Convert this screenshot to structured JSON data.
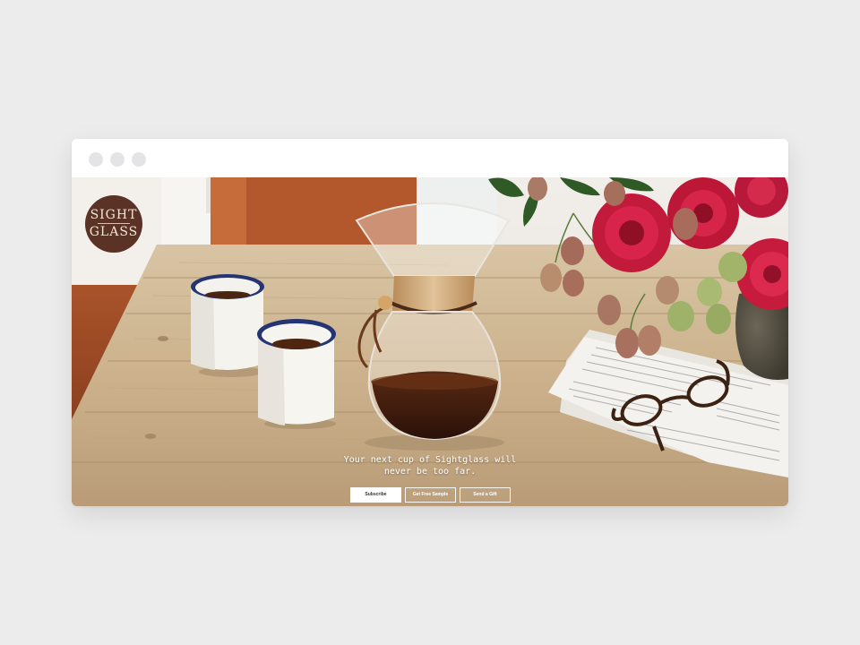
{
  "brand": {
    "logo_line1": "SIGHT",
    "logo_line2": "GLASS",
    "logo_color": "#5b3226"
  },
  "hero": {
    "tagline_line1": "Your next cup of Sightglass will",
    "tagline_line2": "never be too far.",
    "image_subject": "coffee-table-scene"
  },
  "actions": {
    "subscribe_label": "Subscribe",
    "samples_label": "Get Free Sample",
    "gift_label": "Send a Gift"
  },
  "window": {
    "controls": [
      "close",
      "minimize",
      "maximize"
    ]
  },
  "colors": {
    "background": "#ececed",
    "window": "#ffffff",
    "window_dot": "#e4e4e6"
  }
}
